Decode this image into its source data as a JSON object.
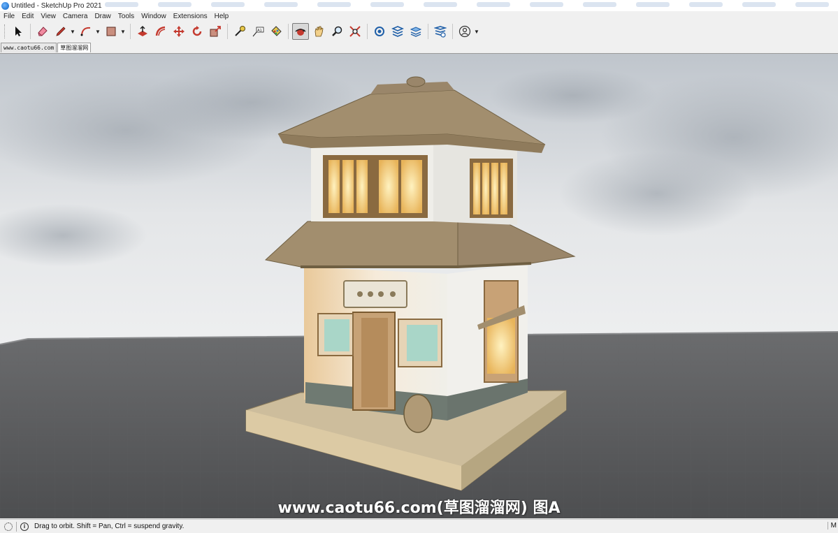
{
  "window": {
    "title": "Untitled - SketchUp Pro 2021"
  },
  "menu": [
    "File",
    "Edit",
    "View",
    "Camera",
    "Draw",
    "Tools",
    "Window",
    "Extensions",
    "Help"
  ],
  "toolbar": {
    "tools": [
      {
        "name": "select-icon"
      },
      {
        "name": "eraser-icon"
      },
      {
        "name": "pencil-line-icon"
      },
      {
        "name": "arc-icon"
      },
      {
        "name": "rectangle-icon"
      },
      {
        "name": "push-pull-icon"
      },
      {
        "name": "offset-icon"
      },
      {
        "name": "move-icon"
      },
      {
        "name": "rotate-icon"
      },
      {
        "name": "scale-icon"
      },
      {
        "name": "tape-measure-icon"
      },
      {
        "name": "text-icon"
      },
      {
        "name": "paint-bucket-icon"
      },
      {
        "name": "orbit-icon"
      },
      {
        "name": "pan-icon"
      },
      {
        "name": "zoom-icon"
      },
      {
        "name": "zoom-extents-icon"
      },
      {
        "name": "warehouse-icon"
      },
      {
        "name": "extension-warehouse-icon"
      },
      {
        "name": "layers-icon"
      },
      {
        "name": "extension-manager-icon"
      },
      {
        "name": "profile-icon"
      }
    ],
    "text_tool_label": "A1",
    "active_tool": "orbit-icon"
  },
  "scenes": [
    {
      "label": "www.caotu66.com",
      "active": false
    },
    {
      "label": "草图溜溜网",
      "active": true
    }
  ],
  "viewport": {
    "watermark": "www.caotu66.com(草图溜溜网) 图A"
  },
  "statusbar": {
    "message": "Drag to orbit. Shift = Pan, Ctrl = suspend gravity.",
    "info_icon": "i",
    "right_label": "M"
  },
  "colors": {
    "sky": "#d4d9df",
    "ground": "#5a5b5d",
    "roof": "#a28e6e",
    "wall": "#ecebe6",
    "window_glow": "#f5d98a"
  }
}
